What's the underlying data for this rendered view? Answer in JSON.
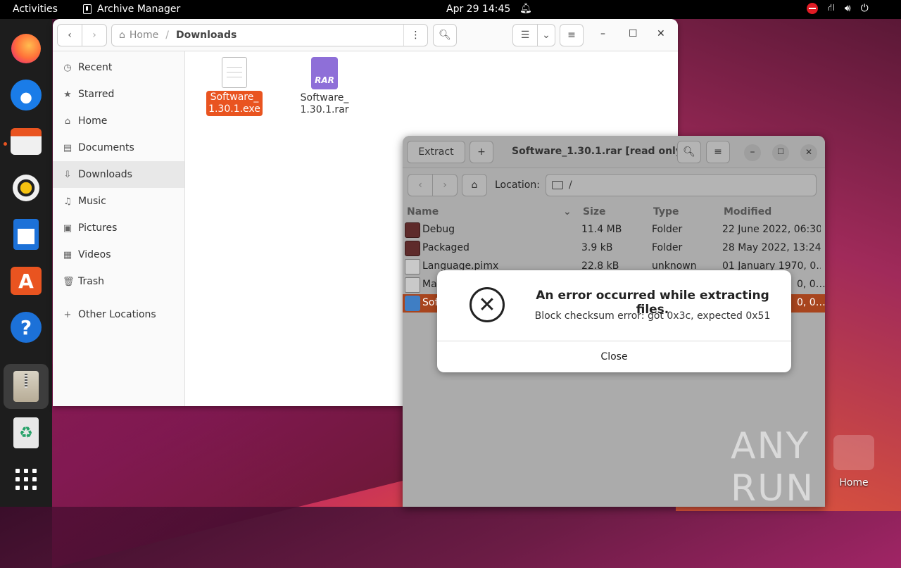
{
  "topbar": {
    "activities": "Activities",
    "app_name": "Archive Manager",
    "clock": "Apr 29  14:45"
  },
  "dock": {
    "items": [
      "firefox-icon",
      "thunderbird-icon",
      "files-icon",
      "rhythmbox-icon",
      "writer-icon",
      "software-icon",
      "help-icon",
      "archive-manager-icon",
      "trash-icon",
      "show-apps-icon"
    ]
  },
  "files": {
    "breadcrumb": {
      "home": "Home",
      "sep": "/",
      "current": "Downloads"
    },
    "sidebar": [
      {
        "label": "Recent",
        "icon": "clock-icon"
      },
      {
        "label": "Starred",
        "icon": "star-icon"
      },
      {
        "label": "Home",
        "icon": "home-icon"
      },
      {
        "label": "Documents",
        "icon": "document-icon"
      },
      {
        "label": "Downloads",
        "icon": "download-icon"
      },
      {
        "label": "Music",
        "icon": "music-icon"
      },
      {
        "label": "Pictures",
        "icon": "picture-icon"
      },
      {
        "label": "Videos",
        "icon": "video-icon"
      },
      {
        "label": "Trash",
        "icon": "trash-icon"
      },
      {
        "label": "Other Locations",
        "icon": "plus-icon"
      }
    ],
    "items": [
      {
        "line1": "Software_",
        "line2": "1.30.1.exe"
      },
      {
        "line1": "Software_",
        "line2": "1.30.1.rar",
        "badge": "RAR"
      }
    ]
  },
  "archive": {
    "extract_label": "Extract",
    "title": "Software_1.30.1.rar [read only]",
    "location_label": "Location:",
    "location_value": "/",
    "columns": {
      "name": "Name",
      "size": "Size",
      "type": "Type",
      "modified": "Modified"
    },
    "rows": [
      {
        "name": "Debug",
        "size": "11.4 MB",
        "type": "Folder",
        "modified": "22 June 2022, 06:30"
      },
      {
        "name": "Packaged",
        "size": "3.9 kB",
        "type": "Folder",
        "modified": "28 May 2022, 13:24"
      },
      {
        "name": "Language.pimx",
        "size": "22.8 kB",
        "type": "unknown",
        "modified": "01 January 1970, 0…"
      },
      {
        "name": "Ma",
        "size": "",
        "type": "",
        "modified": "0, 0…"
      },
      {
        "name": "Sof",
        "size": "",
        "type": "",
        "modified": "0, 0…"
      }
    ]
  },
  "dialog": {
    "title": "An error occurred while extracting files.",
    "message": "Block checksum error: got 0x3c, expected 0x51",
    "close_label": "Close"
  },
  "desktop": {
    "home_label": "Home",
    "watermark": "ANY RUN"
  }
}
